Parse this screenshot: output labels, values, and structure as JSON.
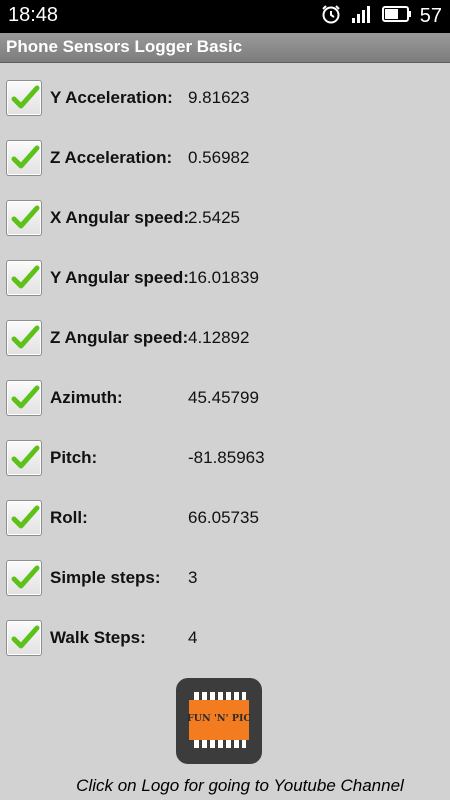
{
  "status_bar": {
    "time": "18:48",
    "battery_level": "57",
    "icons": [
      "alarm-icon",
      "signal-icon",
      "battery-icon"
    ]
  },
  "app": {
    "title": "Phone Sensors Logger Basic"
  },
  "rows": [
    {
      "label": "Y Acceleration:",
      "value": "9.81623",
      "checked": true
    },
    {
      "label": "Z Acceleration:",
      "value": "0.56982",
      "checked": true
    },
    {
      "label": "X Angular speed:",
      "value": "2.5425",
      "checked": true
    },
    {
      "label": "Y Angular speed:",
      "value": "16.01839",
      "checked": true
    },
    {
      "label": "Z Angular speed:",
      "value": "4.12892",
      "checked": true
    },
    {
      "label": "Azimuth:",
      "value": "45.45799",
      "checked": true
    },
    {
      "label": "Pitch:",
      "value": "-81.85963",
      "checked": true
    },
    {
      "label": "Roll:",
      "value": "66.05735",
      "checked": true
    },
    {
      "label": "Simple steps:",
      "value": "3",
      "checked": true
    },
    {
      "label": "Walk Steps:",
      "value": "4",
      "checked": true
    }
  ],
  "logo": {
    "text": "FUN 'N' PIC",
    "colors": {
      "background": "#3c3c3c",
      "chip": "#f47c20",
      "pins": "#ffffff"
    }
  },
  "footer": {
    "text": "Click on Logo for going to Youtube Channel"
  },
  "colors": {
    "check": "#5cc21a",
    "page_background": "#d2d2d2",
    "title_bar": "#8a8a8a"
  }
}
